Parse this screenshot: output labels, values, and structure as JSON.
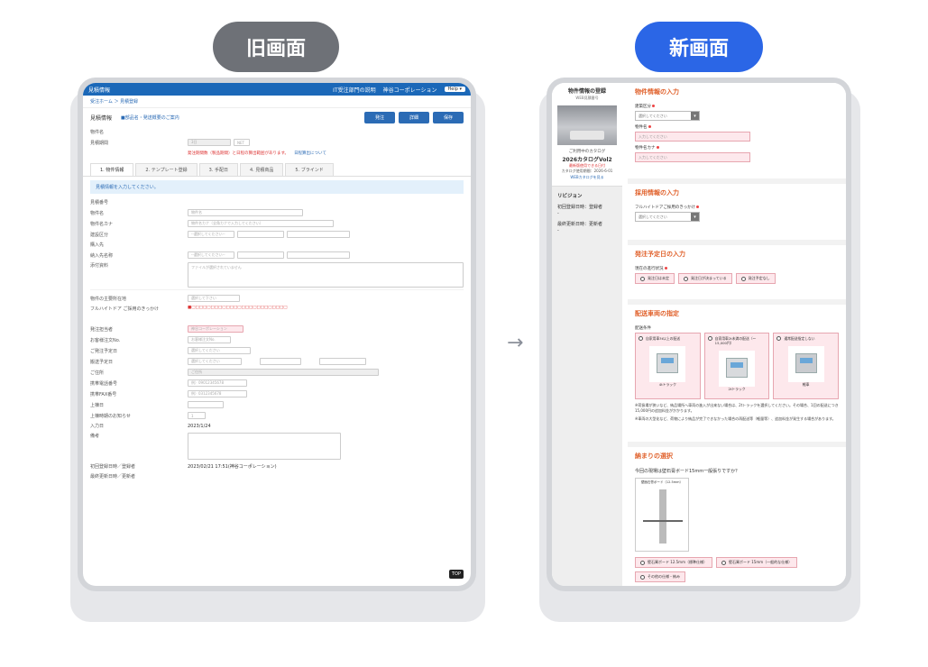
{
  "labels": {
    "old": "旧画面",
    "new": "新画面",
    "arrow": "→"
  },
  "old": {
    "app_title": "見積情報",
    "header_links": [
      "IT受注部門の説明",
      "神谷コーポレーション",
      "Help ▾"
    ],
    "breadcrumb": "受注ホーム ＞ 見積登録",
    "section_title": "見積情報",
    "section_link": "■部品名・発送概要のご案内",
    "buttons": [
      "発注",
      "詳細",
      "保存"
    ],
    "rows": [
      {
        "label": "物件名",
        "value": ""
      },
      {
        "label": "見積期間",
        "value": "3日"
      }
    ],
    "net_label": "NET",
    "notice": "発注期間数（製品期間）と日程の算出範囲があります。",
    "notice_link": "日程算出について",
    "tabs": [
      "1. 物件情報",
      "2. テンプレート登録",
      "3. 手配日",
      "4. 見積商品",
      "5. ブラインド"
    ],
    "info_bar": "見積情報を入力してください。",
    "form_rows": [
      {
        "label": "見積番号",
        "value": ""
      },
      {
        "label": "物件名",
        "value": "物件名"
      },
      {
        "label": "物件名カナ",
        "value": "物件名カナ（全角カナで入力してください）"
      },
      {
        "label": "建設区分",
        "value": "--選択してください--"
      },
      {
        "label": "購入先",
        "value": ""
      },
      {
        "label": "納入先名称",
        "value": "--選択してください--"
      },
      {
        "label": "添付資料",
        "value": "ファイルが選択されていません"
      }
    ],
    "form_rows2": [
      {
        "label": "物件の主要所在地",
        "value": "選択して下さい"
      },
      {
        "label": "フルハイトドア ご採用のきっかけ",
        "value": ""
      },
      {
        "label": "発注担当者",
        "value": "神谷コーポレーション"
      },
      {
        "label": "お客様注文No.",
        "value": "お客様注文No."
      },
      {
        "label": "ご発注予定日",
        "value": "選択してください"
      },
      {
        "label": "搬送予定日",
        "value": "選択してください"
      },
      {
        "label": "ご住所",
        "value": "ご住所"
      },
      {
        "label": "携帯電話番号",
        "value": "例）09012345678"
      },
      {
        "label": "携帯FAX番号",
        "value": "例）0312345678"
      },
      {
        "label": "上棟日",
        "value": ""
      },
      {
        "label": "上棟時期のお知らせ",
        "value": "1"
      },
      {
        "label": "入力日",
        "value": "2023/1/24"
      },
      {
        "label": "備考",
        "value": ""
      },
      {
        "label": "初回登録日時／登録者",
        "value": "2023/02/21 17:51(神谷コーポレーション)"
      },
      {
        "label": "最終更新日時／更新者",
        "value": ""
      }
    ],
    "top_button": "TOP"
  },
  "new": {
    "side": {
      "title": "物件情報の登録",
      "subtitle": "WEB見積番号",
      "catalog_label": "ご利用中のカタログ",
      "catalog_name": "2026カタログVol2",
      "catalog_red": "最新版使用できる日付",
      "catalog_date": "カタログ使用期間：2026-6-01",
      "catalog_link": "WEBカタログを見る",
      "revision_title": "リビジョン",
      "revision_items": [
        "初回登録日時：登録者",
        "最終更新日時：更新者"
      ],
      "dash": "-"
    },
    "sections": {
      "property": {
        "title": "物件情報の入力",
        "f1": "建築区分",
        "f1_value": "選択してください",
        "f2": "物件名",
        "f2_value": "入力してください",
        "f3": "物件名カナ",
        "f3_value": "入力してください"
      },
      "adoption": {
        "title": "採用情報の入力",
        "f1": "フルハイトドアご採用のきっかけ",
        "f1_value": "選択してください"
      },
      "order": {
        "title": "発注予定日の入力",
        "f1": "現在の進行状況",
        "options": [
          "発注日は未定",
          "発注日が決まっている",
          "発注予定なし"
        ]
      },
      "vehicle": {
        "title": "配送車両の指定",
        "f1": "配送条件",
        "options": [
          "自家用車3t以上の配送",
          "自家用車2t未満の配送（～15,000円）",
          "通常配送指定しない"
        ],
        "truck_labels": [
          "4tトラック",
          "2tトラック",
          "軽車"
        ],
        "note1": "※荷扱場が狭いなど、納品場所へ車両の進入が出来ない場合は、2tトラックを選択してください。その場合、1回の配送につき15,000円の追加料金がかかります。",
        "note2": "※車両の大型化など、荷物により納品が完了できなかった場合の再配送等（軽量等）、追加料金が発生する場合があります。"
      },
      "finish": {
        "title": "納まりの選択",
        "question": "今回の現場は壁石膏ボード15mm一般張りですか？",
        "diagram_caption": "壁面石膏ボード（12.5mm）",
        "options": [
          "壁石膏ボード 12.5mm（標準仕様）",
          "壁石膏ボード 15mm（一般的な仕様）",
          "その他の仕様・納み"
        ]
      }
    }
  }
}
